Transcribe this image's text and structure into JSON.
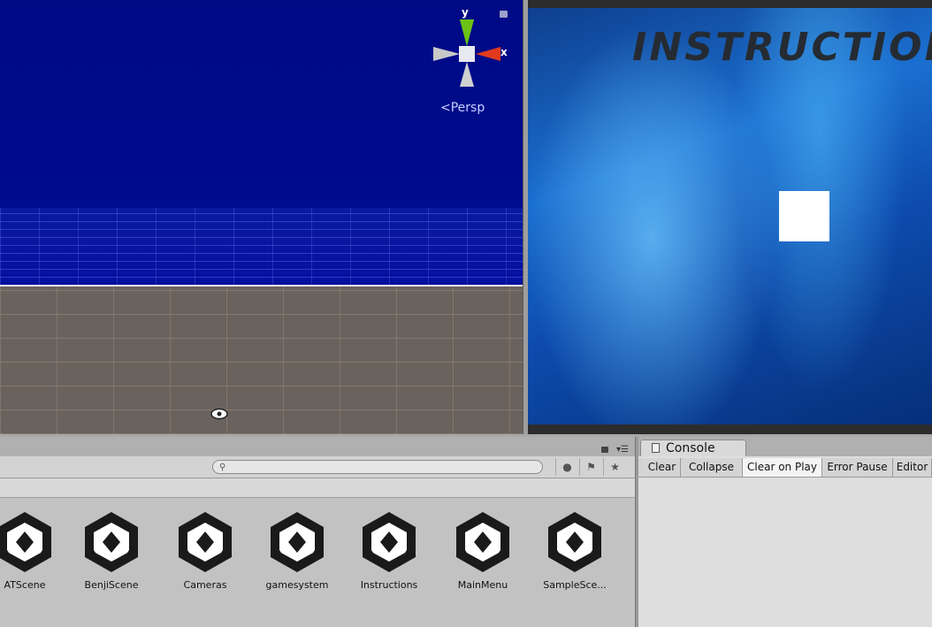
{
  "scene": {
    "axis_y": "y",
    "axis_x": "x",
    "projection": "Persp",
    "sky_color": "#000a8a",
    "ground_color": "#6a625c"
  },
  "game": {
    "title": "INSTRUCTION",
    "square_color": "#ffffff"
  },
  "project": {
    "search_placeholder": "",
    "menu_glyph": "▾☰",
    "toolbar_icons": [
      "search-icon",
      "type-filter-icon",
      "label-filter-icon",
      "favorite-star-icon"
    ],
    "assets": [
      {
        "label": "ATScene"
      },
      {
        "label": "BenjiScene"
      },
      {
        "label": "Cameras"
      },
      {
        "label": "gamesystem"
      },
      {
        "label": "Instructions"
      },
      {
        "label": "MainMenu"
      },
      {
        "label": "SampleSce..."
      }
    ]
  },
  "console": {
    "tab_label": "Console",
    "buttons": [
      {
        "label": "Clear",
        "active": false
      },
      {
        "label": "Collapse",
        "active": false
      },
      {
        "label": "Clear on Play",
        "active": true
      },
      {
        "label": "Error Pause",
        "active": false
      },
      {
        "label": "Editor",
        "active": false
      }
    ]
  }
}
